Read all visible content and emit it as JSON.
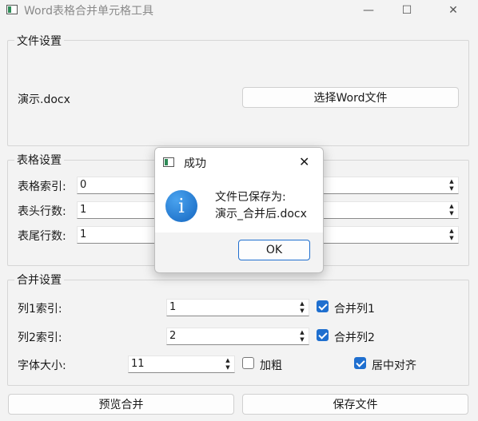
{
  "window": {
    "title": "Word表格合并单元格工具",
    "minimize_glyph": "—",
    "maximize_glyph": "☐",
    "close_glyph": "✕"
  },
  "file_settings": {
    "group_title": "文件设置",
    "file_name": "演示.docx",
    "select_button": "选择Word文件"
  },
  "table_settings": {
    "group_title": "表格设置",
    "table_index_label": "表格索引:",
    "table_index_value": "0",
    "header_rows_label": "表头行数:",
    "header_rows_value": "1",
    "footer_rows_label": "表尾行数:",
    "footer_rows_value": "1"
  },
  "merge_settings": {
    "group_title": "合并设置",
    "col1_label": "列1索引:",
    "col1_value": "1",
    "merge_col1_label": "合并列1",
    "merge_col1_checked": true,
    "col2_label": "列2索引:",
    "col2_value": "2",
    "merge_col2_label": "合并列2",
    "merge_col2_checked": true,
    "font_size_label": "字体大小:",
    "font_size_value": "11",
    "bold_label": "加粗",
    "bold_checked": false,
    "center_label": "居中对齐",
    "center_checked": true
  },
  "actions": {
    "preview_button": "预览合并",
    "save_button": "保存文件"
  },
  "dialog": {
    "title": "成功",
    "message_line1": "文件已保存为:",
    "message_line2": "演示_合并后.docx",
    "ok_button": "OK",
    "icon": "info-icon",
    "close_glyph": "✕"
  },
  "colors": {
    "accent": "#1f6fcf",
    "background": "#f3f3f3"
  }
}
